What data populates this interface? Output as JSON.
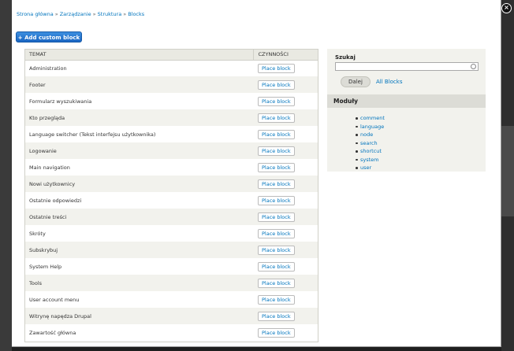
{
  "breadcrumb": [
    {
      "label": "Strona główna"
    },
    {
      "label": "Zarządzanie"
    },
    {
      "label": "Struktura"
    },
    {
      "label": "Blocks"
    }
  ],
  "breadcrumb_separator": "»",
  "close_label": "×",
  "add_button_label": "+ Add custom block",
  "table": {
    "headers": {
      "subject": "TEMAT",
      "actions": "CZYNNOŚCI"
    },
    "place_label": "Place block",
    "rows": [
      "Administration",
      "Footer",
      "Formularz wyszukiwania",
      "Kto przegląda",
      "Language switcher (Tekst interfejsu użytkownika)",
      "Logowanie",
      "Main navigation",
      "Nowi użytkownicy",
      "Ostatnie odpowiedzi",
      "Ostatnie treści",
      "Skróty",
      "Subskrybuj",
      "System Help",
      "Tools",
      "User account menu",
      "Witrynę napędza Drupal",
      "Zawartość główna"
    ]
  },
  "sidebar": {
    "search_label": "Szukaj",
    "search_value": "",
    "submit_label": "Dalej",
    "all_blocks_label": "All Blocks",
    "modules_title": "Moduły",
    "modules": [
      "comment",
      "language",
      "node",
      "search",
      "shortcut",
      "system",
      "user"
    ]
  },
  "colors": {
    "link": "#0074bd",
    "primary_button": "#1a66c2"
  }
}
